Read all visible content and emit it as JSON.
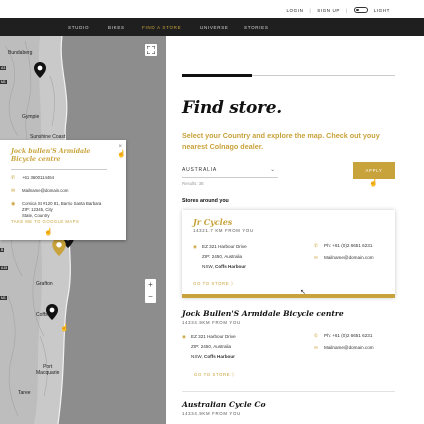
{
  "utility": {
    "login": "LOGIN",
    "divider1": "|",
    "signup": "SIGN UP",
    "divider2": "|",
    "light": "LIGHT"
  },
  "nav": {
    "items": [
      "STUDIO",
      "BIKES",
      "FIND A STORE",
      "UNIVERSE",
      "STORIES"
    ],
    "active": "FIND A STORE"
  },
  "map": {
    "labels": {
      "bundaberg": "Bundaberg",
      "gympie": "Gympie",
      "sunshine_coast": "Sunshine Coast",
      "grafton": "Grafton",
      "coffs": "Coffs",
      "port_macquarie": "Port\nMacquarie",
      "taree": "Taree"
    },
    "road_badges": [
      "A3",
      "M1",
      "B",
      "A15",
      "M1"
    ],
    "zoom_in": "+",
    "zoom_out": "−",
    "popup": {
      "close": "×",
      "title": "Jock bullen'S Armidale Bicycle centre",
      "phone": "+61 3600114464",
      "email": "Mailname@domain.com",
      "address_line1": "Corsica St #120 81, Barrio Santa Barbara",
      "address_line2": "ZIP: 12345, City",
      "address_line3": "State, Country",
      "google_maps": "TAKE ME TO GOOGLE MAPS"
    }
  },
  "panel": {
    "title": "Find store.",
    "intro": "Select your Country and explore the map. Check out youy nearest Colnago dealer.",
    "country": "AUSTRALIA",
    "results": "Results: 38",
    "apply": "APPLY",
    "stores_around": "Stores around you",
    "stores": [
      {
        "name": "Jr Cycles",
        "distance": "14321.7 KM FROM YOU",
        "address1": "EZ 321 Harbour Drive",
        "address2": "ZIP: 2450, Australia",
        "address3_prefix": "NSW, ",
        "address3_bold": "Coffs Harbour",
        "phone": "Ph: +61 (0)2 6651 6231",
        "email": "Mailname@domain.com",
        "goto": "GO TO STORE  〉"
      },
      {
        "name": "Jock Bullen'S Armidale Bicycle centre",
        "distance": "14334.9KM FROM YOU",
        "address1": "EZ 321 Harbour Drive",
        "address2": "ZIP: 2450, Australia",
        "address3_prefix": "NSW, ",
        "address3_bold": "Coffs Harbour",
        "phone": "Ph: +61 (0)2 6651 6231",
        "email": "Mailname@domain.com",
        "goto": "GO TO STORE  〉"
      },
      {
        "name": "Australian Cycle Co",
        "distance": "14334.9KM FROM YOU"
      }
    ]
  },
  "colors": {
    "gold": "#c8a23a",
    "dark": "#1f1f1f"
  }
}
